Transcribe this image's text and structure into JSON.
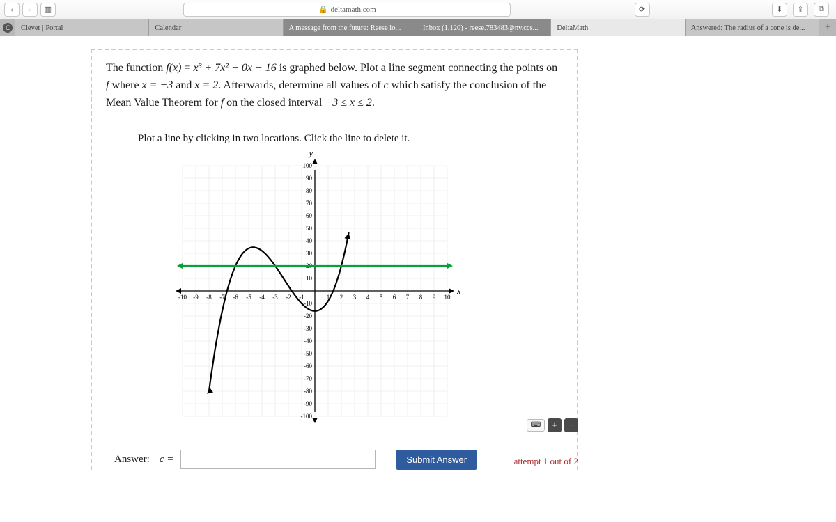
{
  "browser": {
    "url_host": "deltamath.com",
    "tabs": [
      {
        "label": "Clever | Portal",
        "active": false
      },
      {
        "label": "Calendar",
        "active": false
      },
      {
        "label": "A message from the future: Reese lo...",
        "active": false,
        "dark": true
      },
      {
        "label": "Inbox (1,120) - reese.783483@nv.ccs...",
        "active": false,
        "dark": true
      },
      {
        "label": "DeltaMath",
        "active": true
      },
      {
        "label": "Answered: The radius of a cone is de...",
        "active": false
      }
    ]
  },
  "problem": {
    "func_lhs": "f(x)",
    "func_rhs": "x³ + 7x² + 0x − 16",
    "text_a": "The function ",
    "text_b": " is graphed below. Plot a line segment connecting the points on ",
    "text_c": " where ",
    "cond1": "x = −3",
    "text_d": " and ",
    "cond2": "x = 2",
    "text_e": ". Afterwards, determine all values of ",
    "varc": "c",
    "text_f": " which satisfy the conclusion of the Mean Value Theorem for ",
    "text_g": " on the closed interval ",
    "interval": "−3 ≤ x ≤ 2",
    "period": "."
  },
  "instruction": "Plot a line by clicking in two locations. Click the line to delete it.",
  "answer_label": "Answer:",
  "answer_var": "c =",
  "answer_value": "",
  "submit_label": "Submit Answer",
  "attempt_text": "attempt 1 out of 2",
  "chart_data": {
    "type": "line",
    "title": "",
    "xlabel": "x",
    "ylabel": "y",
    "xlim": [
      -10,
      10
    ],
    "ylim": [
      -100,
      100
    ],
    "xticks": [
      -10,
      -9,
      -8,
      -7,
      -6,
      -5,
      -4,
      -3,
      -2,
      -1,
      1,
      2,
      3,
      4,
      5,
      6,
      7,
      8,
      9,
      10
    ],
    "yticks": [
      -100,
      -90,
      -80,
      -70,
      -60,
      -50,
      -40,
      -30,
      -20,
      -10,
      10,
      20,
      30,
      40,
      50,
      60,
      70,
      80,
      90,
      100
    ],
    "series": [
      {
        "name": "f(x)=x^3+7x^2+0x-16",
        "x_range": [
          -8,
          2.5
        ],
        "sample_points": [
          {
            "x": -8,
            "y": -80
          },
          {
            "x": -7,
            "y": -16
          },
          {
            "x": -6,
            "y": 20
          },
          {
            "x": -5,
            "y": 34
          },
          {
            "x": -4,
            "y": 32
          },
          {
            "x": -3,
            "y": 20
          },
          {
            "x": -2,
            "y": 4
          },
          {
            "x": -1,
            "y": -10
          },
          {
            "x": 0,
            "y": -16
          },
          {
            "x": 1,
            "y": -8
          },
          {
            "x": 2,
            "y": 20
          },
          {
            "x": 2.5,
            "y": 43.4
          }
        ],
        "color": "#000"
      },
      {
        "name": "secant/user-line",
        "endpoints": [
          {
            "x": -10,
            "y": 20
          },
          {
            "x": 10,
            "y": 20
          }
        ],
        "color": "#0a9f3c"
      }
    ]
  }
}
